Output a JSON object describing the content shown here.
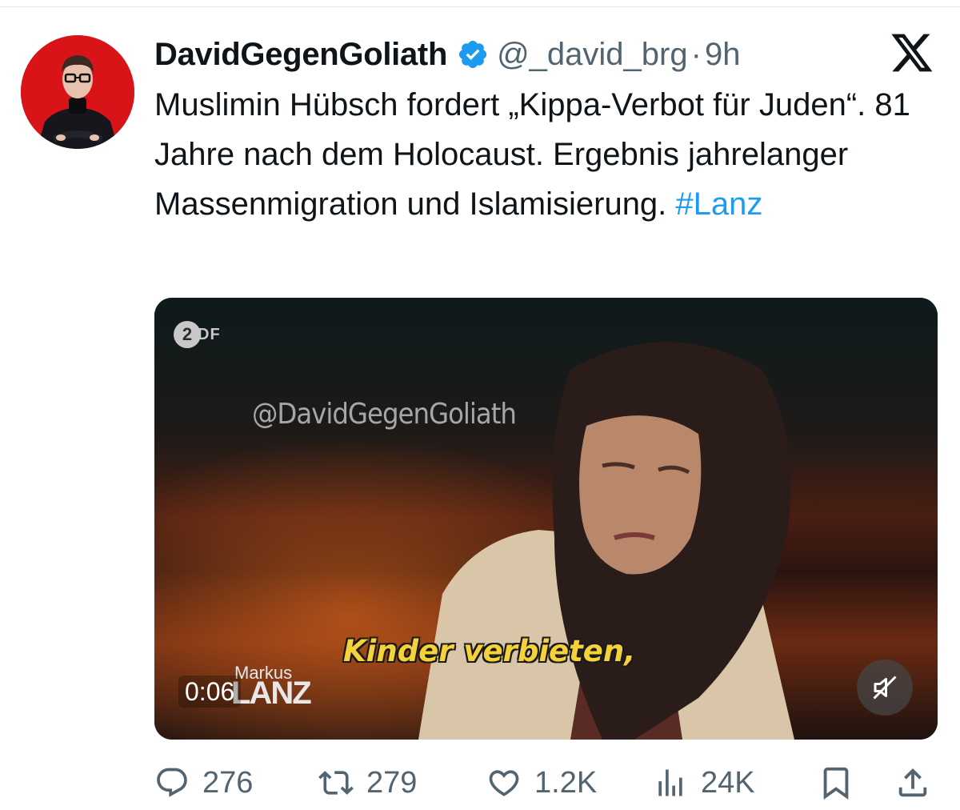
{
  "tweet": {
    "display_name": "DavidGegenGoliath",
    "handle": "@_david_brg",
    "separator": "·",
    "time": "9h",
    "text_main": "Muslimin Hübsch fordert „Kippa-Verbot für Juden“. 81 Jahre nach dem Holocaust. Ergebnis jahrelanger Massenmigration und Islamisierung.",
    "hashtag": "#Lanz"
  },
  "media": {
    "channel_logo_mark": "2",
    "channel_logo_text": "DF",
    "watermark": "@DavidGegenGoliath",
    "subtitle": "Kinder verbieten,",
    "show_logo_top": "Markus",
    "show_logo_bottom": "LANZ",
    "timestamp": "0:06"
  },
  "actions": {
    "replies": "276",
    "reposts": "279",
    "likes": "1.2K",
    "views": "24K"
  },
  "icons": {
    "verified": "verified-badge-icon",
    "x_logo": "x-logo-icon",
    "reply": "reply-icon",
    "repost": "repost-icon",
    "like": "heart-icon",
    "views": "views-icon",
    "bookmark": "bookmark-icon",
    "share": "share-icon",
    "mute": "muted-speaker-icon"
  },
  "colors": {
    "link": "#1d9bf0",
    "verified": "#1d9bf0",
    "secondary_text": "#536471",
    "subtitle": "#f5d23a",
    "avatar_bg": "#d81418"
  }
}
